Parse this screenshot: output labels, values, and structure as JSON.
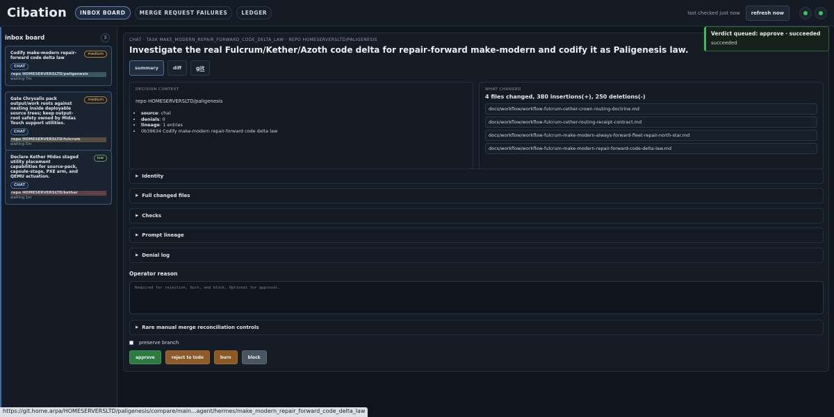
{
  "app": {
    "title": "Cibation",
    "nav": [
      {
        "label": "INBOX BOARD"
      },
      {
        "label": "MERGE REQUEST FAILURES"
      },
      {
        "label": "LEDGER"
      }
    ],
    "last_checked": "last checked just now",
    "refresh_label": "refresh now",
    "status_color": "#3cc65a"
  },
  "sidebar": {
    "title": "inbox board",
    "count": "3",
    "cards": [
      {
        "title": "Codify make-modern repair-forward code delta law",
        "priority": "medium",
        "type": "CHAT",
        "repo": "repo HOMESERVERSLTD/paligenesis",
        "waiting": "waiting 7m"
      },
      {
        "title": "Gate Chrysalis pack output/work roots against nesting inside deployable source trees; keep output-root safety owned by Midas Touch support utilities.",
        "priority": "medium",
        "type": "CHAT",
        "repo": "repo HOMESERVERSLTD/fulcrum",
        "waiting": "waiting 5m"
      },
      {
        "title": "Declare Kether Midas staged utility placement capabilities for source-pack, capsule-stage, PXE arm, and QEMU actuation.",
        "priority": "low",
        "type": "CHAT",
        "repo": "repo HOMESERVERSLTD/kether",
        "waiting": "waiting 1m"
      }
    ]
  },
  "main": {
    "breadcrumb": "CHAT · TASK MAKE_MODERN_REPAIR_FORWARD_CODE_DELTA_LAW · REPO HOMESERVERSLTD/PALIGENESIS",
    "title": "Investigate the real Fulcrum/Kether/Azoth code delta for repair-forward make-modern and codify it as Paligenesis law.",
    "tabs": [
      {
        "label": "summary"
      },
      {
        "label": "diff"
      },
      {
        "label": "git"
      }
    ],
    "decision_context": {
      "label": "DECISION CONTEXT",
      "repo": "repo HOMESERVERSLTD/paligenesis",
      "items": [
        {
          "key": "source",
          "value": ": chat"
        },
        {
          "key": "denials",
          "value": ": 0"
        },
        {
          "key": "lineage",
          "value": ": 1 entries"
        },
        {
          "key": "",
          "value": "0b39634 Codify make-modern repair-forward code delta law"
        }
      ]
    },
    "what_changed": {
      "label": "WHAT CHANGED",
      "summary": "4 files changed, 380 insertions(+), 250 deletions(-)",
      "files": [
        "docs/workflow/workflow-fulcrum-cether-crown-routing-doctrine.md",
        "docs/workflow/workflow-fulcrum-cether-routing-receipt-contract.md",
        "docs/workflow/workflow-fulcrum-make-modern-always-forward-fleet-repair-north-star.md",
        "docs/workflow/workflow-fulcrum-make-modern-repair-forward-code-delta-law.md"
      ]
    },
    "sections": [
      {
        "label": "Identity"
      },
      {
        "label": "Full changed files"
      },
      {
        "label": "Checks"
      },
      {
        "label": "Prompt lineage"
      },
      {
        "label": "Denial log"
      }
    ],
    "operator_reason": {
      "label": "Operator reason",
      "placeholder": "Required for rejection, burn, and block. Optional for approval."
    },
    "manual_controls": "Rare manual merge reconciliation controls",
    "preserve_branch": "preserve branch",
    "actions": {
      "approve": "approve",
      "reject": "reject to todo",
      "burn": "burn",
      "block": "block"
    }
  },
  "toast": {
    "title": "Verdict queued: approve · succeeded",
    "subtitle": "succeeded"
  },
  "status_url": "https://git.home.arpa/HOMESERVERSLTD/paligenesis/compare/main...agent/hermes/make_modern_repair_forward_code_delta_law"
}
